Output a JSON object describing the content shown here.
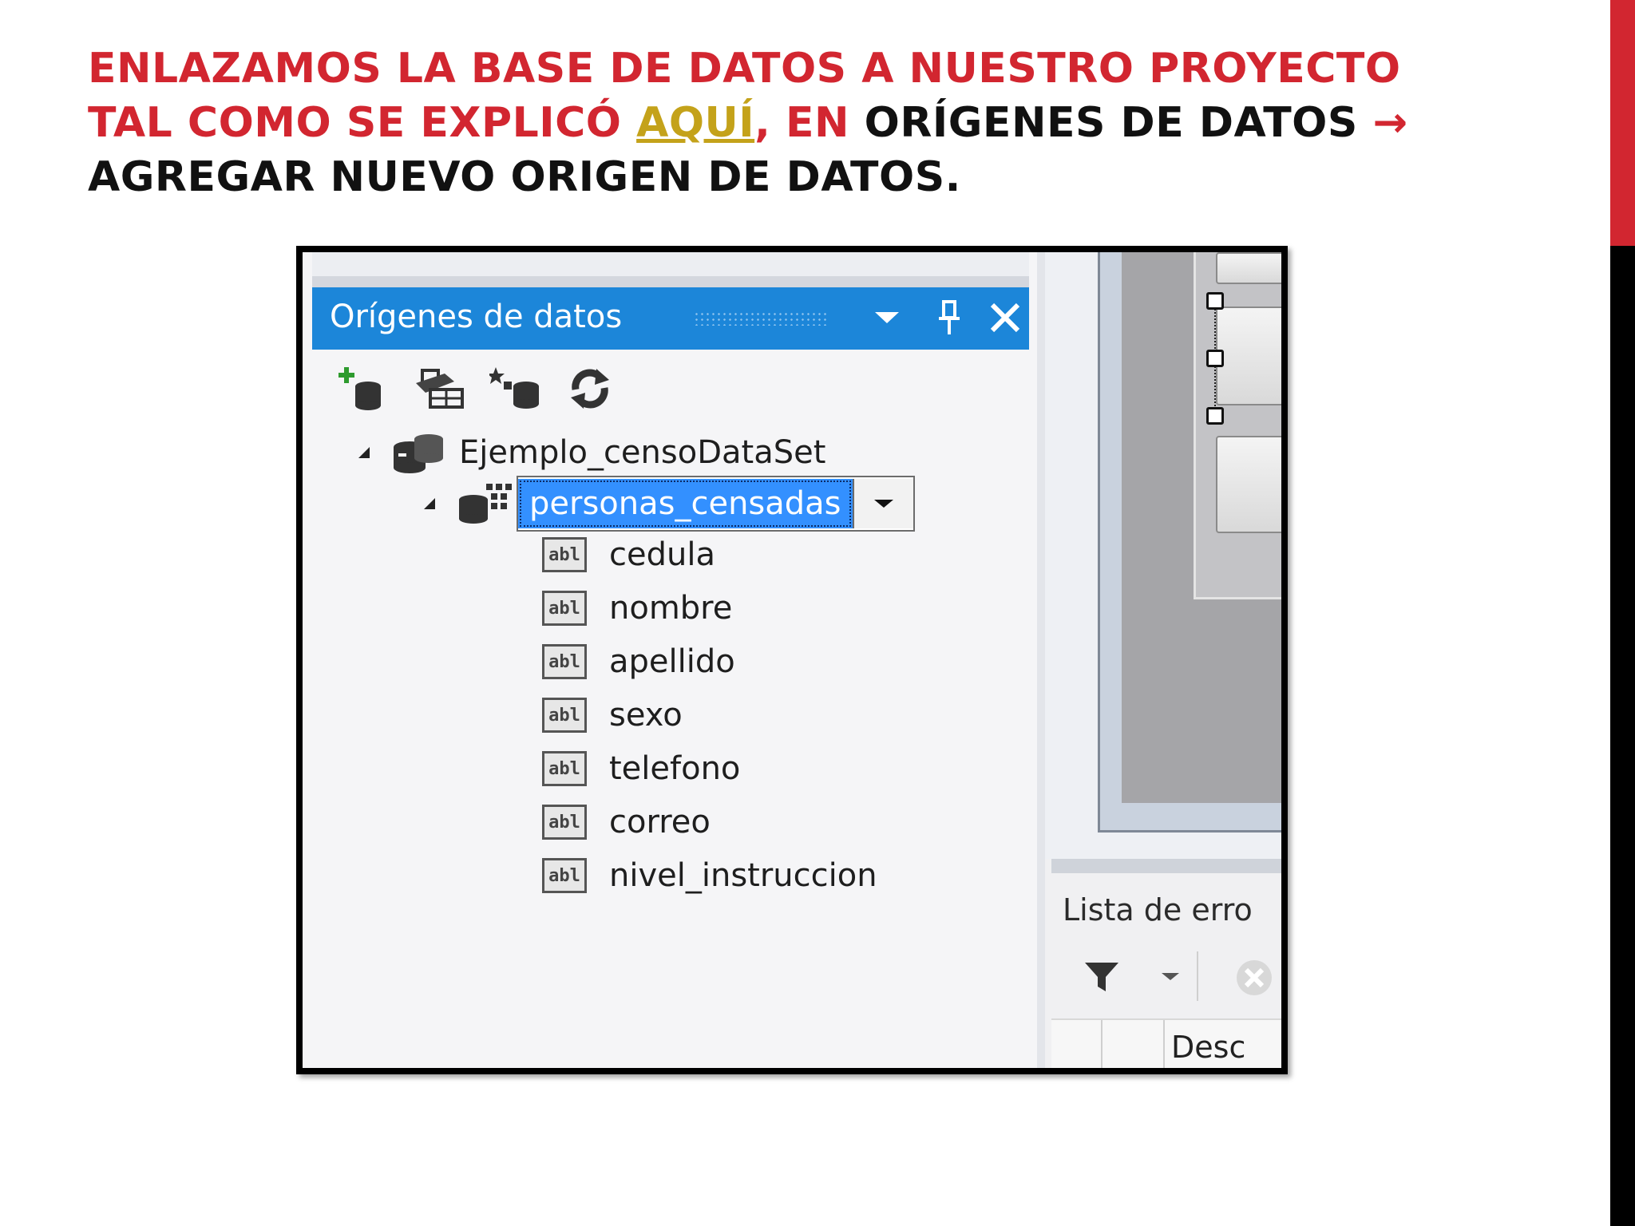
{
  "slide": {
    "title_line1": "ENLAZAMOS LA BASE DE DATOS A NUESTRO PROYECTO",
    "title_line2_part1": "TAL COMO SE EXPLICÓ ",
    "title_link": "AQUÍ",
    "title_line2_part2": ", EN ",
    "title_line2_dark": "ORÍGENES DE DATOS ",
    "title_arrow": "→",
    "title_line3": "AGREGAR NUEVO ORIGEN DE DATOS.",
    "colors": {
      "title_red": "#d22630",
      "link_gold": "#c4a21a",
      "dark": "#111111",
      "accent_red": "#d22630",
      "accent_black": "#000000"
    }
  },
  "data_sources_panel": {
    "title": "Orígenes de datos",
    "title_bar_color": "#1c86d9",
    "buttons": {
      "dropdown_icon": "chevron-down-icon",
      "pin_icon": "pin-icon",
      "close_icon": "close-icon"
    },
    "toolbar_icons": [
      "add-data-source-icon",
      "edit-dataset-icon",
      "configure-dataset-icon",
      "refresh-icon"
    ],
    "dataset": {
      "name": "Ejemplo_censoDataSet",
      "table": {
        "name": "personas_censadas",
        "selection_color": "#3390ff",
        "fields": [
          {
            "name": "cedula",
            "icon_text": "abl"
          },
          {
            "name": "nombre",
            "icon_text": "abl"
          },
          {
            "name": "apellido",
            "icon_text": "abl"
          },
          {
            "name": "sexo",
            "icon_text": "abl"
          },
          {
            "name": "telefono",
            "icon_text": "abl"
          },
          {
            "name": "correo",
            "icon_text": "abl"
          },
          {
            "name": "nivel_instruccion",
            "icon_text": "abl"
          }
        ]
      }
    }
  },
  "error_list": {
    "title": "Lista de erro",
    "column_header": "Desc"
  }
}
